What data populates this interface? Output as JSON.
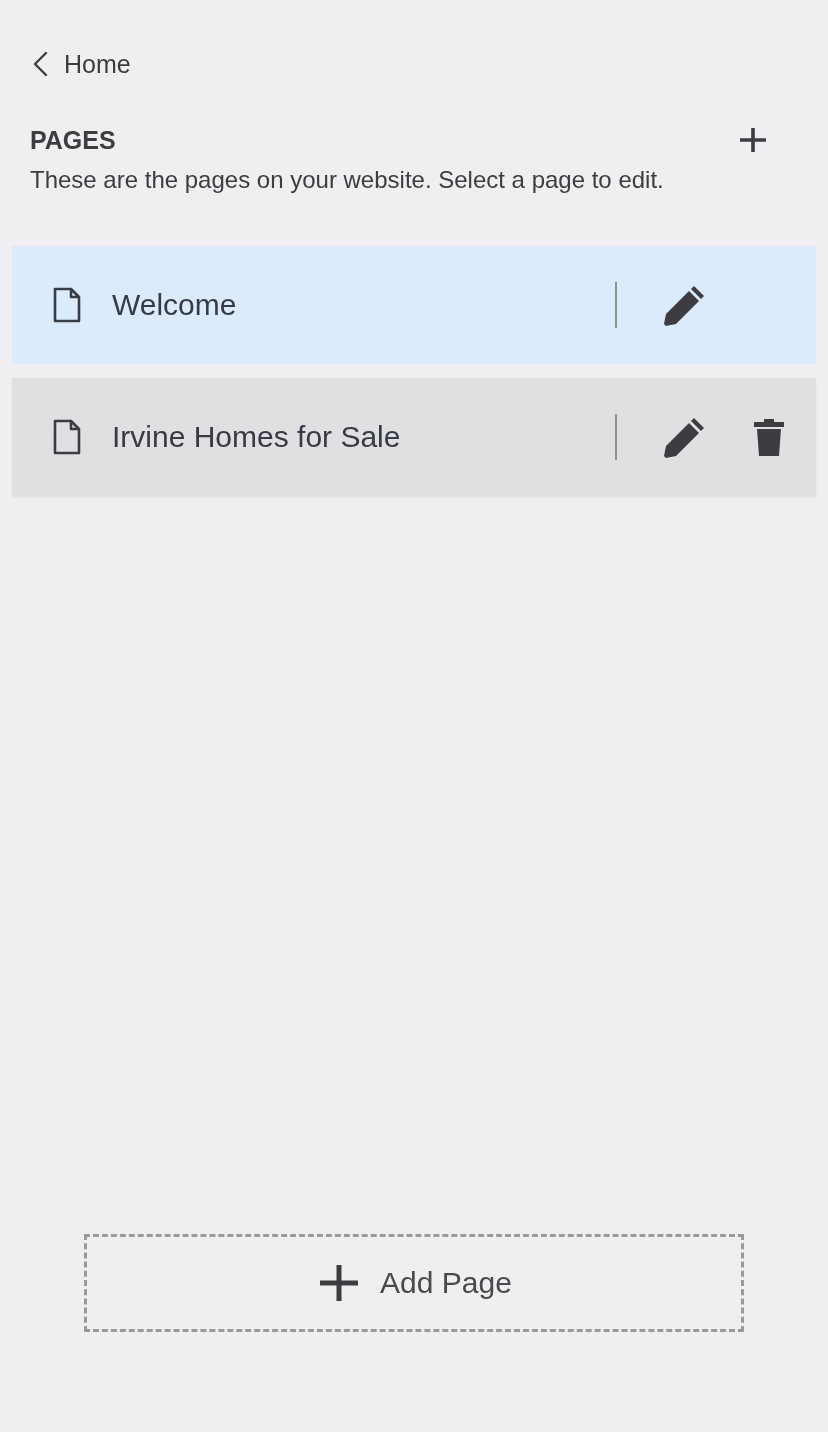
{
  "back_link": {
    "label": "Home"
  },
  "header": {
    "title": "PAGES",
    "description": "These are the pages on your website. Select a page to edit."
  },
  "pages": [
    {
      "title": "Welcome",
      "selected": true,
      "deletable": false
    },
    {
      "title": "Irvine Homes for Sale",
      "selected": false,
      "deletable": true
    }
  ],
  "add_button": {
    "label": "Add Page"
  }
}
